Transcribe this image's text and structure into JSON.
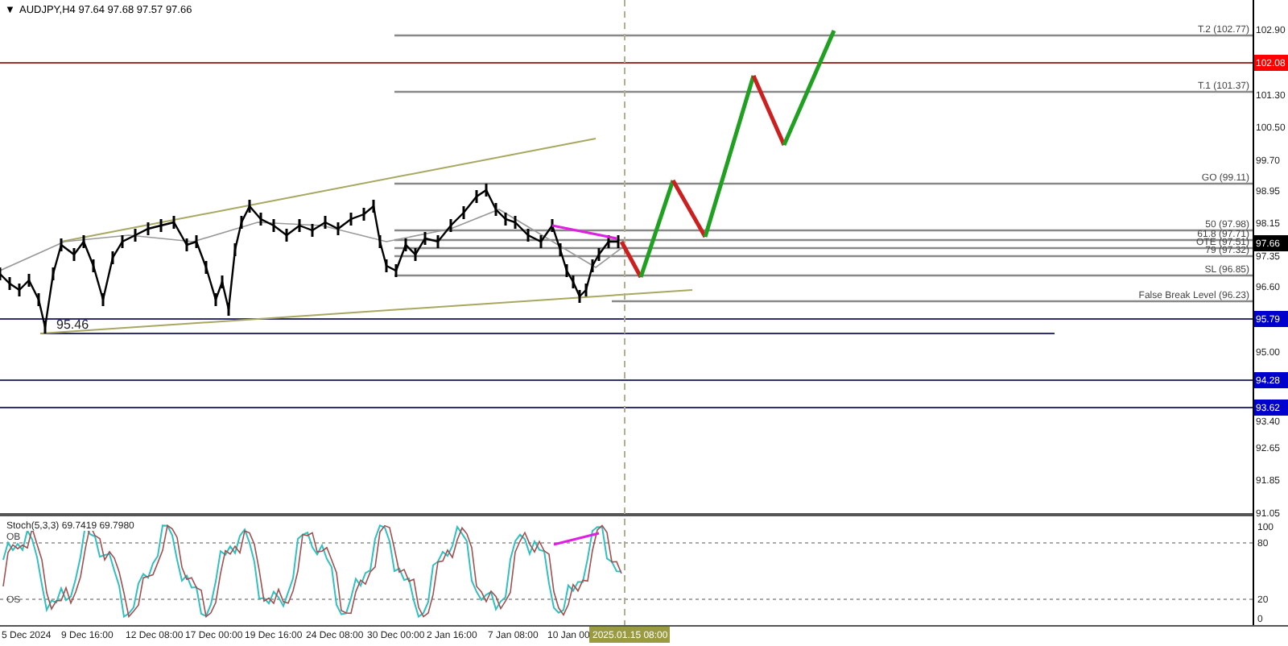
{
  "header": {
    "arrow": "▼",
    "title": "AUDJPY,H4 97.64 97.68 97.57 97.66"
  },
  "price_axis": {
    "ticks": [
      "102.90",
      "101.30",
      "100.50",
      "99.70",
      "98.95",
      "98.15",
      "97.35",
      "96.60",
      "95.00",
      "93.40",
      "92.65",
      "91.85",
      "91.05"
    ]
  },
  "price_badges": [
    {
      "text": "102.08",
      "color": "#ff0000"
    },
    {
      "text": "97.66",
      "color": "#000000"
    },
    {
      "text": "95.79",
      "color": "#0000cc"
    },
    {
      "text": "94.28",
      "color": "#0000cc"
    },
    {
      "text": "93.62",
      "color": "#0000cc"
    }
  ],
  "levels": [
    {
      "label": "T.2 (102.77)"
    },
    {
      "label": "T.1 (101.37)"
    },
    {
      "label": "GO (99.11)"
    },
    {
      "label": "50 (97.98)"
    },
    {
      "label": "61.8 (97.71)"
    },
    {
      "label": "OTE (97.51)"
    },
    {
      "label": "79 (97.32)"
    },
    {
      "label": "SL (96.85)"
    },
    {
      "label": "False Break Level (96.23)"
    }
  ],
  "low_marker": "95.46",
  "oscillator": {
    "title": "Stoch(5,3,3) 69.7419 69.7980",
    "zones": [
      "OB",
      "OS"
    ],
    "axis_ticks": [
      "100",
      "80",
      "20",
      "0"
    ]
  },
  "time_axis": {
    "labels": [
      "5 Dec 2024",
      "9 Dec 16:00",
      "12 Dec 08:00",
      "17 Dec 00:00",
      "19 Dec 16:00",
      "24 Dec 08:00",
      "30 Dec 00:00",
      "2 Jan 16:00",
      "7 Jan 08:00",
      "10 Jan 00"
    ],
    "cursor_label": "2025.01.15 08:00"
  }
}
